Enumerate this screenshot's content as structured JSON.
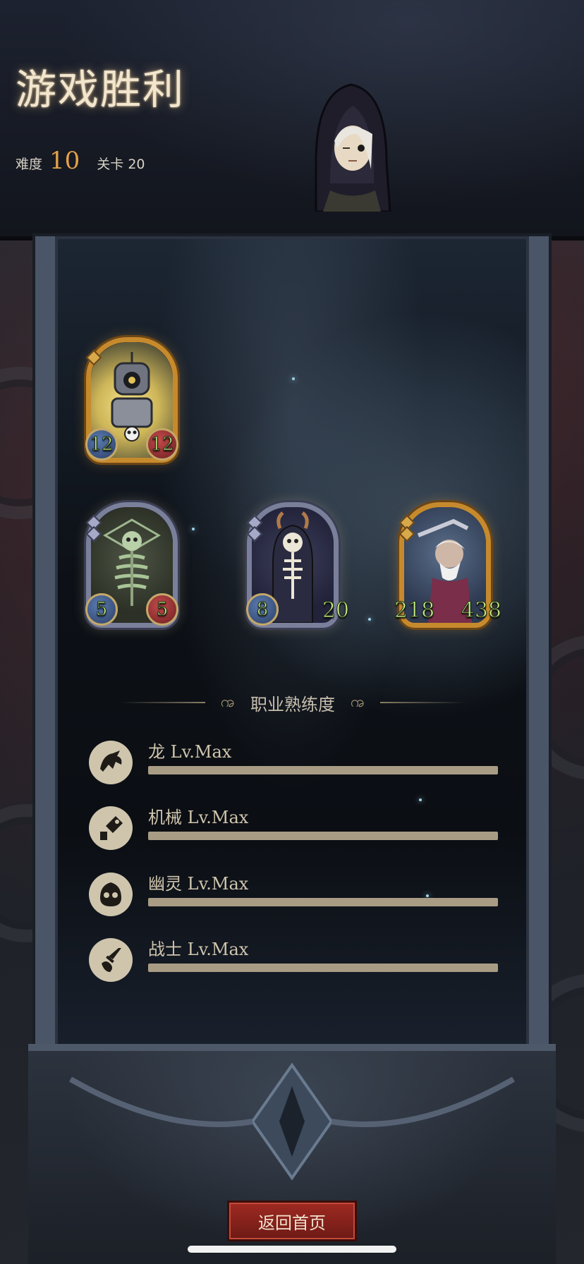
{
  "header": {
    "title": "游戏胜利",
    "difficulty_label": "难度",
    "difficulty_value": "10",
    "stage_label": "关卡 20"
  },
  "cards": [
    {
      "frame": "gold",
      "attack": "12",
      "health": "12",
      "subject": "mech-skull-minion"
    },
    {
      "frame": "silver",
      "attack": "5",
      "health": "5",
      "subject": "ghost-skeleton"
    },
    {
      "frame": "silver",
      "attack": "8",
      "health": "20",
      "subject": "horned-skeleton-lord"
    },
    {
      "frame": "gold",
      "attack": "218",
      "health": "438",
      "subject": "old-warrior-with-sword"
    }
  ],
  "mastery": {
    "title": "职业熟练度",
    "items": [
      {
        "icon": "dragon-icon",
        "label": "龙 Lv.Max",
        "progress": 1.0
      },
      {
        "icon": "mech-icon",
        "label": "机械 Lv.Max",
        "progress": 1.0
      },
      {
        "icon": "ghost-icon",
        "label": "幽灵 Lv.Max",
        "progress": 1.0
      },
      {
        "icon": "warrior-icon",
        "label": "战士 Lv.Max",
        "progress": 1.0
      }
    ]
  },
  "buttons": {
    "return_home": "返回首页"
  },
  "colors": {
    "title_glow": "#f2e6cf",
    "difficulty_value": "#e4a04a",
    "stat_text": "#c9f08c",
    "button_red": "#9e2a22"
  }
}
